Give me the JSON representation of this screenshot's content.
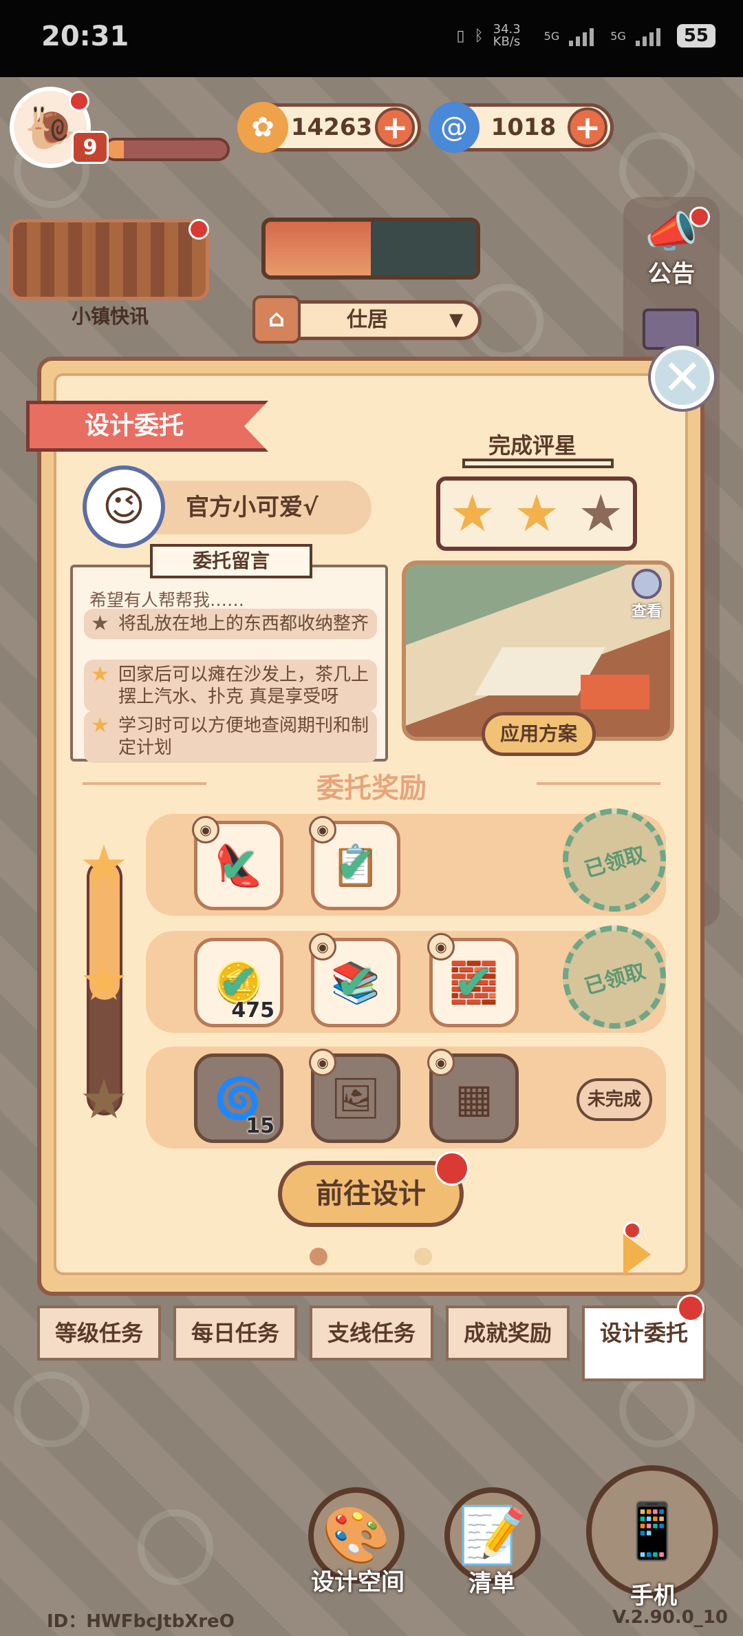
{
  "status_bar": {
    "time": "20:31",
    "net_speed": "34.3 KB/s",
    "net_label_1": "5G",
    "net_label_2": "5G",
    "battery": "55"
  },
  "hud": {
    "level": "9",
    "xp_fraction": 0.15,
    "coins": "14263",
    "gems": "1018",
    "news_label": "小镇快讯",
    "place_label": "仕居",
    "notice_label": "公告"
  },
  "modal": {
    "title": "设计委托",
    "client_name": "官方小可爱√",
    "message_label": "委托留言",
    "message_intro": "希望有人帮帮我……",
    "requirements": [
      {
        "text": "将乱放在地上的东西都收纳整齐",
        "icon": "★",
        "color": "#7a5a4a"
      },
      {
        "text": "回家后可以瘫在沙发上，茶几上摆上汽水、扑克 真是享受呀",
        "icon": "★",
        "color": "#f2b14a"
      },
      {
        "text": "学习时可以方便地查阅期刊和制定计划",
        "icon": "★",
        "color": "#f2b14a"
      }
    ],
    "rating_title": "完成评星",
    "rating": {
      "earned": 2,
      "total": 3
    },
    "view_label": "查看",
    "apply_label": "应用方案",
    "reward_title": "委托奖励",
    "reward_progress": 0.55,
    "tiers": [
      {
        "status": "已领取",
        "items": [
          {
            "icon": "👠",
            "qty": "",
            "checked": true,
            "eye": true
          },
          {
            "icon": "📋",
            "qty": "",
            "checked": true,
            "eye": true
          }
        ]
      },
      {
        "status": "已领取",
        "items": [
          {
            "icon": "🪙",
            "qty": "475",
            "checked": true,
            "eye": false
          },
          {
            "icon": "📚",
            "qty": "",
            "checked": true,
            "eye": true
          },
          {
            "icon": "🧱",
            "qty": "",
            "checked": true,
            "eye": true
          }
        ]
      },
      {
        "status": "未完成",
        "items": [
          {
            "icon": "🌀",
            "qty": "15",
            "checked": false,
            "eye": false
          },
          {
            "icon": "🖼",
            "qty": "",
            "checked": false,
            "eye": true
          },
          {
            "icon": "▦",
            "qty": "",
            "checked": false,
            "eye": true
          }
        ]
      }
    ],
    "go_label": "前往设计"
  },
  "tabs": [
    "等级任务",
    "每日任务",
    "支线任务",
    "成就奖励",
    "设计委托"
  ],
  "active_tab": 4,
  "bottom_buttons": {
    "design_space": "设计空间",
    "checklist": "清单",
    "phone": "手机"
  },
  "footer": {
    "id": "ID：HWFbcJtbXreO",
    "version": "V.2.90.0_10"
  },
  "colors": {
    "accent_red": "#d93a33",
    "ribbon": "#e96e62",
    "star_gold": "#f2b14a",
    "stamp_green": "#5c9874"
  }
}
